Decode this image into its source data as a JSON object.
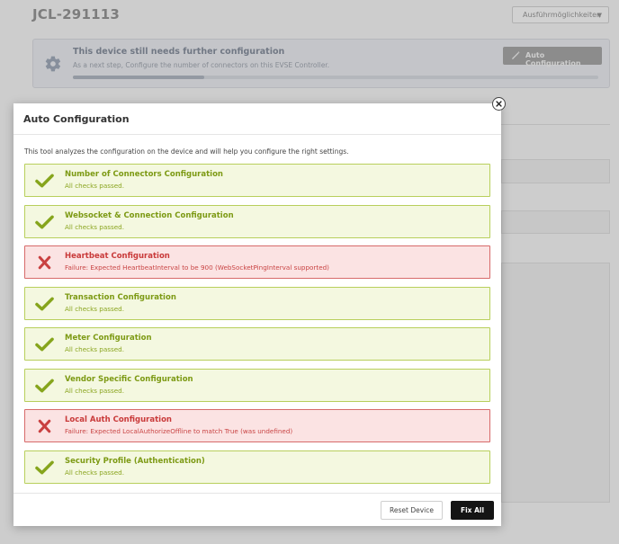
{
  "page": {
    "title": "JCL-291113",
    "actions_dropdown": "Ausführmöglichkeiten",
    "banner": {
      "title": "This device still needs further configuration",
      "subtitle": "As a next step, Configure the number of connectors on this EVSE Controller.",
      "progress": 0.25,
      "button_label": "Auto Configuration"
    }
  },
  "modal": {
    "title": "Auto Configuration",
    "intro": "This tool analyzes the configuration on the device and will help you configure the right settings.",
    "checks": [
      {
        "title": "Number of Connectors Configuration",
        "message": "All checks passed.",
        "status": "pass"
      },
      {
        "title": "Websocket & Connection Configuration",
        "message": "All checks passed.",
        "status": "pass"
      },
      {
        "title": "Heartbeat Configuration",
        "message": "Failure: Expected HeartbeatInterval to be 900 (WebSocketPingInterval supported)",
        "status": "fail"
      },
      {
        "title": "Transaction Configuration",
        "message": "All checks passed.",
        "status": "pass"
      },
      {
        "title": "Meter Configuration",
        "message": "All checks passed.",
        "status": "pass"
      },
      {
        "title": "Vendor Specific Configuration",
        "message": "All checks passed.",
        "status": "pass"
      },
      {
        "title": "Local Auth Configuration",
        "message": "Failure: Expected LocalAuthorizeOffline to match True (was undefined)",
        "status": "fail"
      },
      {
        "title": "Security Profile (Authentication)",
        "message": "All checks passed.",
        "status": "pass"
      }
    ],
    "reset_label": "Reset Device",
    "fix_label": "Fix All"
  },
  "colors": {
    "pass_border": "#b8cf5c",
    "pass_bg": "#f4f8e0",
    "pass_text": "#7d9a14",
    "fail_border": "#d76a6a",
    "fail_bg": "#fbe3e3",
    "fail_text": "#c93a3a",
    "primary_button": "#141414"
  },
  "icons": {
    "pass": "checkmark-icon",
    "fail": "cross-icon",
    "close": "close-icon",
    "banner": "gear-icon",
    "auto_config": "magic-wand-icon",
    "dropdown": "caret-down-icon"
  }
}
